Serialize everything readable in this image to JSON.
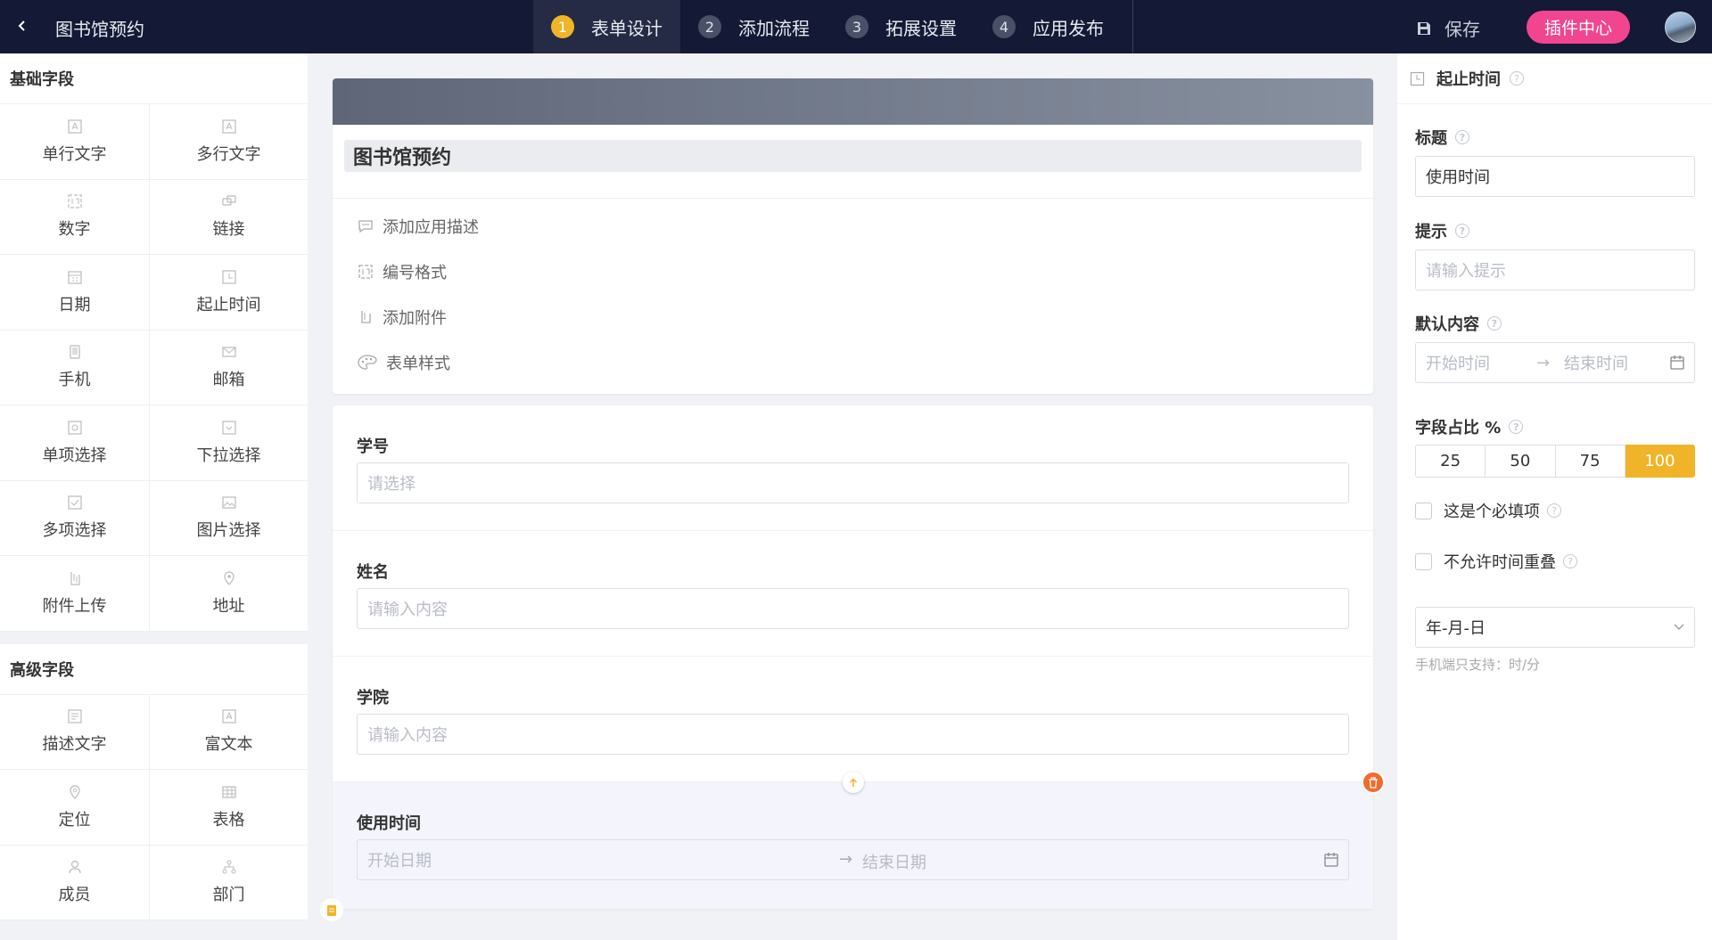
{
  "header": {
    "app_title": "图书馆预约",
    "steps": [
      {
        "num": "1",
        "label": "表单设计"
      },
      {
        "num": "2",
        "label": "添加流程"
      },
      {
        "num": "3",
        "label": "拓展设置"
      },
      {
        "num": "4",
        "label": "应用发布"
      }
    ],
    "save_label": "保存",
    "plugin_label": "插件中心"
  },
  "left": {
    "basic_title": "基础字段",
    "basic_fields": [
      {
        "label": "单行文字",
        "icon": "single-line-text-icon"
      },
      {
        "label": "多行文字",
        "icon": "multi-line-text-icon"
      },
      {
        "label": "数字",
        "icon": "number-icon"
      },
      {
        "label": "链接",
        "icon": "link-icon"
      },
      {
        "label": "日期",
        "icon": "date-icon"
      },
      {
        "label": "起止时间",
        "icon": "time-range-icon"
      },
      {
        "label": "手机",
        "icon": "phone-icon"
      },
      {
        "label": "邮箱",
        "icon": "email-icon"
      },
      {
        "label": "单项选择",
        "icon": "radio-icon"
      },
      {
        "label": "下拉选择",
        "icon": "dropdown-icon"
      },
      {
        "label": "多项选择",
        "icon": "checkbox-icon"
      },
      {
        "label": "图片选择",
        "icon": "image-icon"
      },
      {
        "label": "附件上传",
        "icon": "attachment-icon"
      },
      {
        "label": "地址",
        "icon": "location-pin-icon"
      }
    ],
    "advanced_title": "高级字段",
    "advanced_fields": [
      {
        "label": "描述文字",
        "icon": "description-icon"
      },
      {
        "label": "富文本",
        "icon": "rich-text-icon"
      },
      {
        "label": "定位",
        "icon": "location-icon"
      },
      {
        "label": "表格",
        "icon": "table-icon"
      },
      {
        "label": "成员",
        "icon": "member-icon"
      },
      {
        "label": "部门",
        "icon": "department-icon"
      }
    ]
  },
  "form": {
    "title": "图书馆预约",
    "options": [
      {
        "label": "添加应用描述",
        "icon": "comment-icon"
      },
      {
        "label": "编号格式",
        "icon": "number-format-icon"
      },
      {
        "label": "添加附件",
        "icon": "attachment-icon"
      },
      {
        "label": "表单样式",
        "icon": "palette-icon"
      }
    ],
    "fields": [
      {
        "label": "学号",
        "placeholder": "请选择"
      },
      {
        "label": "姓名",
        "placeholder": "请输入内容"
      },
      {
        "label": "学院",
        "placeholder": "请输入内容"
      }
    ],
    "selected_field": {
      "label": "使用时间",
      "start_placeholder": "开始日期",
      "arrow": "→",
      "end_placeholder": "结束日期"
    }
  },
  "props": {
    "panel_title": "起止时间",
    "title_label": "标题",
    "title_value": "使用时间",
    "hint_label": "提示",
    "hint_placeholder": "请输入提示",
    "default_label": "默认内容",
    "default_start": "开始时间",
    "default_arrow": "→",
    "default_end": "结束时间",
    "ratio_label": "字段占比 %",
    "ratio_options": [
      "25",
      "50",
      "75",
      "100"
    ],
    "ratio_selected": "100",
    "required_label": "这是个必填项",
    "no_overlap_label": "不允许时间重叠",
    "format_value": "年-月-日",
    "mobile_note": "手机端只支持：时/分"
  },
  "colors": {
    "topbar": "#141a35",
    "accent": "#f0b429",
    "plugin": "#f2458f",
    "delete": "#f26a2a"
  }
}
